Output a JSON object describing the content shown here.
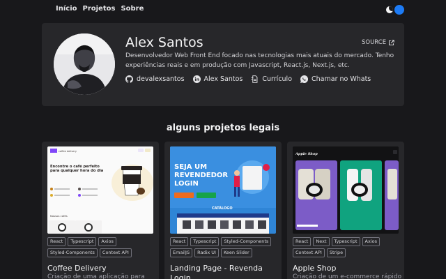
{
  "nav": {
    "links": [
      "Início",
      "Projetos",
      "Sobre"
    ]
  },
  "colors": {
    "background": "#18181b",
    "card": "#27272a",
    "accent": "#1d7bf5"
  },
  "profile": {
    "name": "Alex Santos",
    "source_label": "SOURCE",
    "bio": "Desenvolvedor Web Front End focado nas tecnologias mais atuais do mercado. Tenho experiências reais e em produção com Javascript, React.js, Next.js, etc.",
    "links": [
      {
        "icon": "github-icon",
        "label": "devalexsantos"
      },
      {
        "icon": "linkedin-icon",
        "label": "Alex Santos"
      },
      {
        "icon": "document-icon",
        "label": "Currículo"
      },
      {
        "icon": "whatsapp-icon",
        "label": "Chamar no Whats"
      }
    ]
  },
  "projects": {
    "title": "alguns projetos legais",
    "items": [
      {
        "title": "Coffee Delivery",
        "desc": "Criação de uma aplicação para",
        "tags": [
          "React",
          "Typescript",
          "Axios",
          "Styled-Components",
          "Context API"
        ],
        "thumb": {
          "headline": "Encontre o café perfeito para qualquer hora do dia",
          "section": "Nossos cafés",
          "logo": "coffee delivery"
        }
      },
      {
        "title": "Landing Page - Revenda",
        "title2": "Login",
        "desc": "",
        "tags": [
          "React",
          "Typescript",
          "Styled-Components",
          "EmailJS",
          "Radix UI",
          "Keen Slider"
        ],
        "thumb": {
          "headline": "SEJA UM REVENDEDOR LOGIN",
          "section": "CATÁLOGO"
        }
      },
      {
        "title": "Apple Shop",
        "desc": "Criação de um e-commerce rápido",
        "tags": [
          "React",
          "Next",
          "Typescript",
          "Axios",
          "Context API",
          "Stripe"
        ],
        "thumb": {
          "logo": "Apple Shop"
        }
      }
    ]
  }
}
